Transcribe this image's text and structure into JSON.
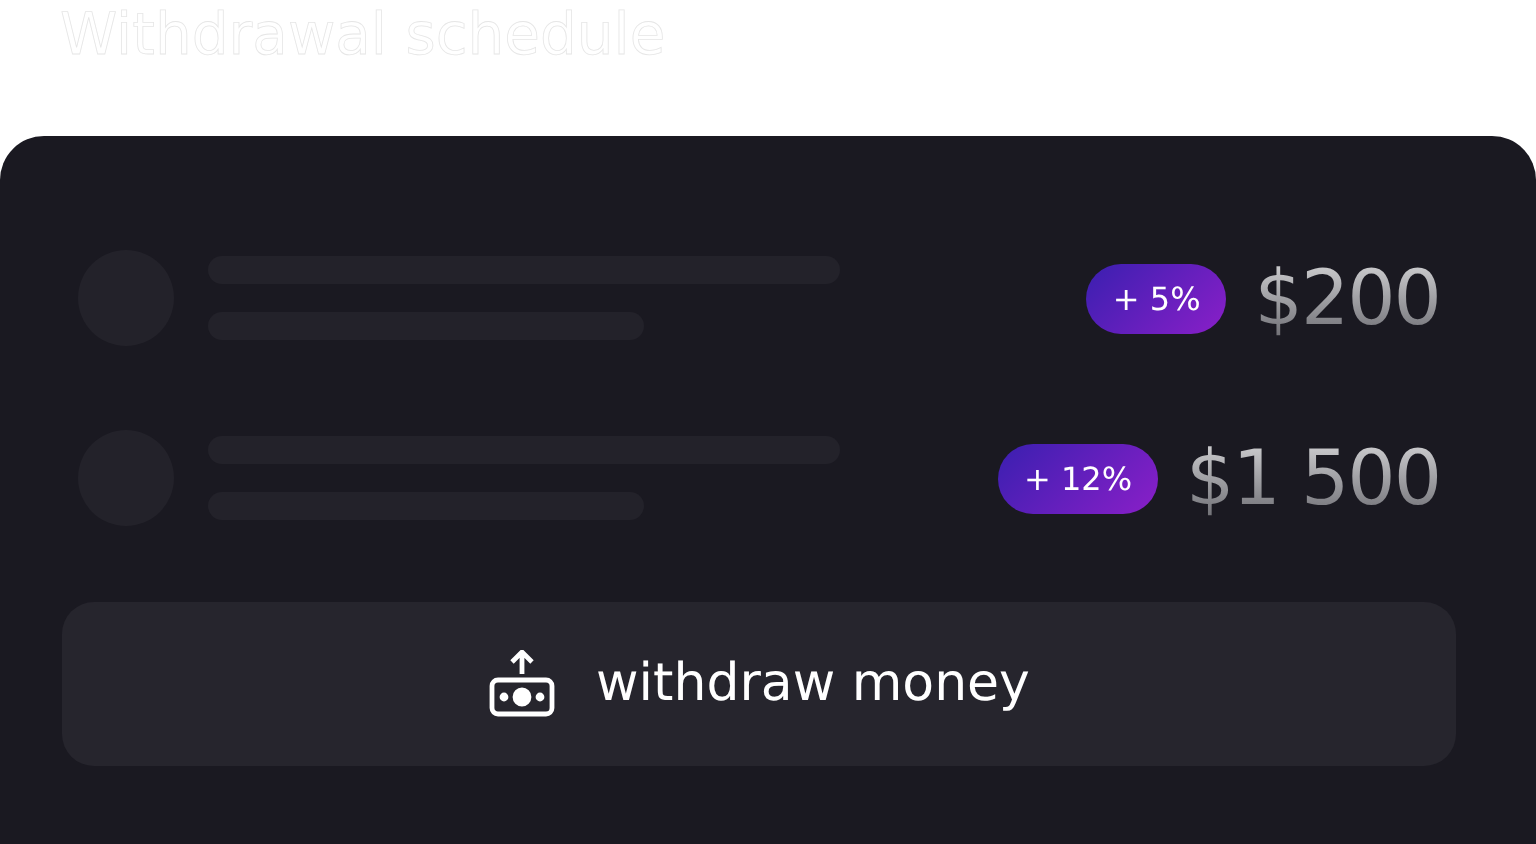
{
  "title": "Withdrawal schedule",
  "payouts": [
    {
      "bonus": "+ 5%",
      "amount": "$200"
    },
    {
      "bonus": "+ 12%",
      "amount": "$1 500"
    }
  ],
  "button": {
    "label": "withdraw money"
  }
}
